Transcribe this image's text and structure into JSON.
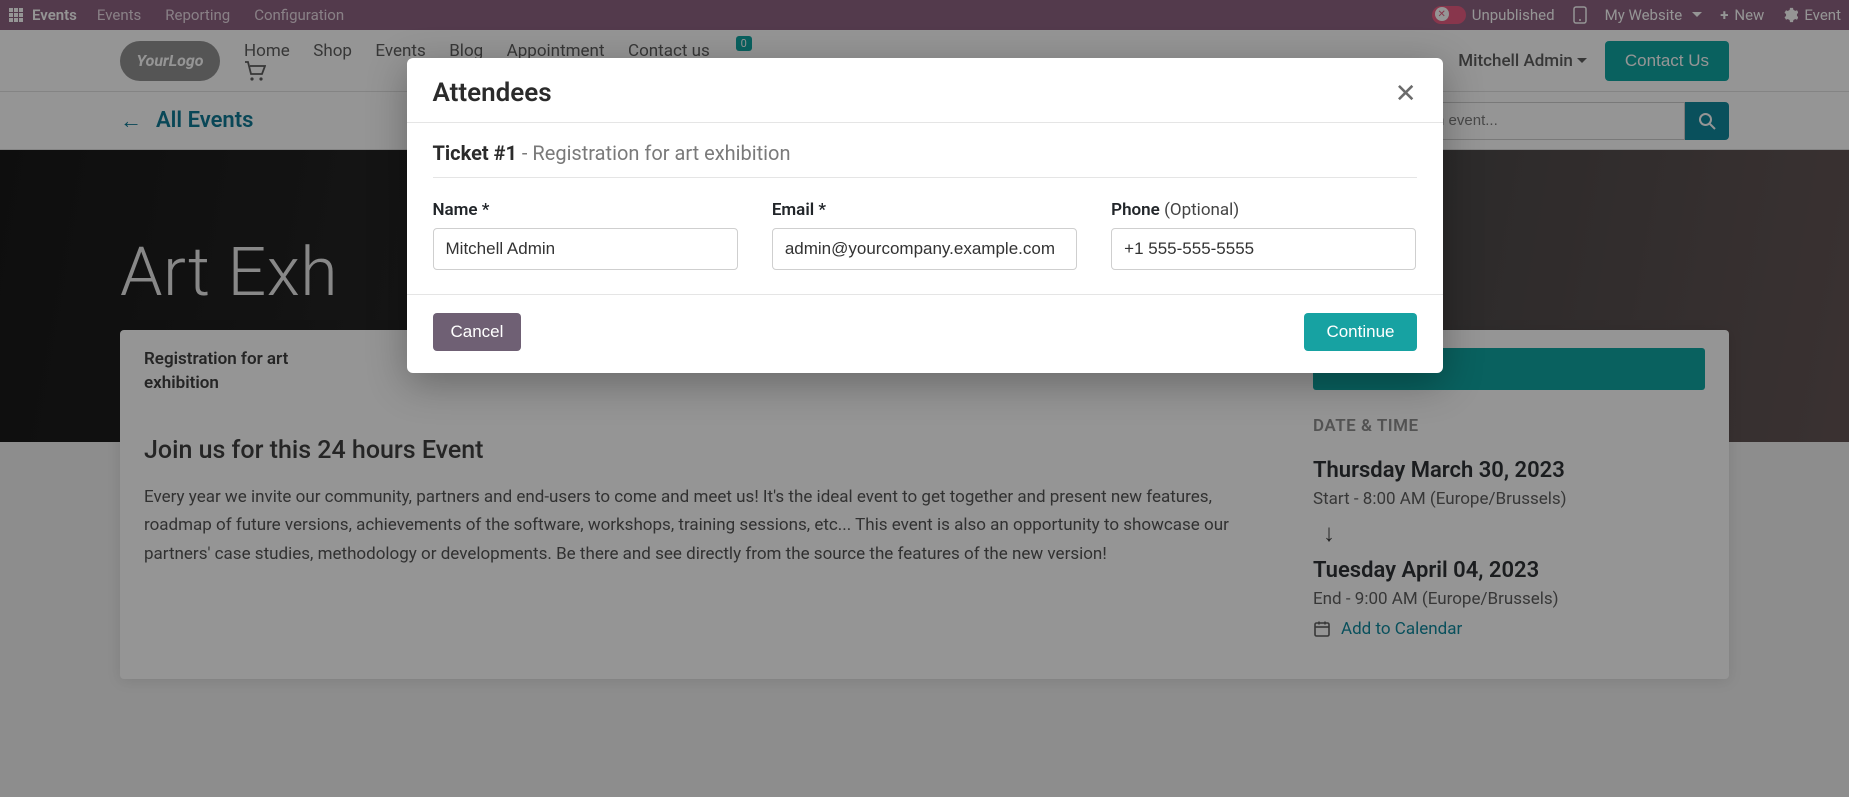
{
  "topbar": {
    "brand": "Events",
    "menu": [
      "Events",
      "Reporting",
      "Configuration"
    ],
    "unpublished": "Unpublished",
    "my_website": "My Website",
    "new": "New",
    "event": "Event"
  },
  "siteheader": {
    "logo_text": "YourLogo",
    "nav": [
      "Home",
      "Shop",
      "Events",
      "Blog",
      "Appointment",
      "Contact us"
    ],
    "cart_count": "0",
    "user": "Mitchell Admin",
    "contact_btn": "Contact Us"
  },
  "subbar": {
    "all_events": "All Events",
    "search_placeholder": "Search an event..."
  },
  "hero": {
    "title": "Art Exh"
  },
  "content": {
    "reg_label": "Registration for art exhibition",
    "join_heading": "Join us for this 24 hours Event",
    "join_text": "Every year we invite our community, partners and end-users to come and meet us! It's the ideal event to get together and present new features, roadmap of future versions, achievements of the software, workshops, training sessions, etc... This event is also an opportunity to showcase our partners' case studies, methodology or developments. Be there and see directly from the source the features of the new version!",
    "dt_label": "DATE & TIME",
    "start_date": "Thursday March 30, 2023",
    "start_time": "Start - 8:00 AM (Europe/Brussels)",
    "end_date": "Tuesday April 04, 2023",
    "end_time": "End - 9:00 AM (Europe/Brussels)",
    "add_cal": "Add to Calendar"
  },
  "modal": {
    "title": "Attendees",
    "ticket_no": "Ticket #1",
    "ticket_sep": " - ",
    "ticket_desc": "Registration for art exhibition",
    "name_label": "Name *",
    "email_label": "Email *",
    "phone_label": "Phone",
    "phone_opt": "(Optional)",
    "name_value": "Mitchell Admin",
    "email_value": "admin@yourcompany.example.com",
    "phone_value": "+1 555-555-5555",
    "cancel": "Cancel",
    "continue": "Continue"
  }
}
